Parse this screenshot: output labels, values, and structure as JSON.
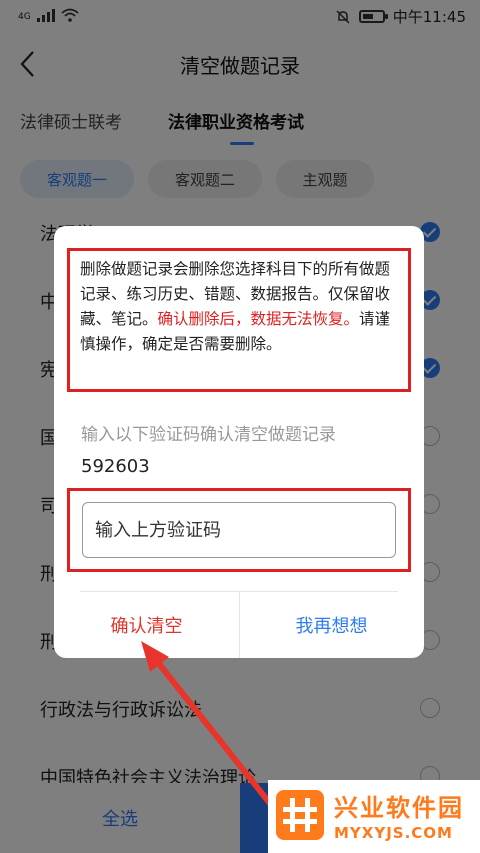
{
  "status_bar": {
    "network": "4G",
    "time": "中午11:45"
  },
  "header": {
    "title": "清空做题记录"
  },
  "exam_tabs": [
    {
      "label": "法律硕士联考"
    },
    {
      "label": "法律职业资格考试"
    }
  ],
  "chips": [
    {
      "label": "客观题一"
    },
    {
      "label": "客观题二"
    },
    {
      "label": "主观题"
    }
  ],
  "subjects": [
    {
      "label": "法理学",
      "checked": true
    },
    {
      "label": "中",
      "checked": true
    },
    {
      "label": "宪",
      "checked": true
    },
    {
      "label": "国",
      "checked": false
    },
    {
      "label": "司",
      "checked": false
    },
    {
      "label": "刑",
      "checked": false
    },
    {
      "label": "刑",
      "checked": false
    },
    {
      "label": "行政法与行政诉讼法",
      "checked": false
    },
    {
      "label": "中国特色社会主义法治理论",
      "checked": false
    }
  ],
  "bottom_bar": {
    "select_all": "全选"
  },
  "dialog": {
    "warning_part1": "删除做题记录会删除您选择科目下的所有做题记录、练习历史、错题、数据报告。仅保留收藏、笔记。",
    "warning_red": "确认删除后，数据无法恢复。",
    "warning_part2": "请谨慎操作，确定是否需要删除。",
    "prompt": "输入以下验证码确认清空做题记录",
    "code": "592603",
    "input_placeholder": "输入上方验证码",
    "confirm_label": "确认清空",
    "cancel_label": "我再想想"
  },
  "watermark": {
    "title": "兴业软件园",
    "subtitle": "MYXYJS.COM"
  },
  "colors": {
    "accent": "#2e7cf6",
    "danger": "#e02020",
    "confirm_text": "#e0352b",
    "watermark": "#ff7a1a"
  }
}
